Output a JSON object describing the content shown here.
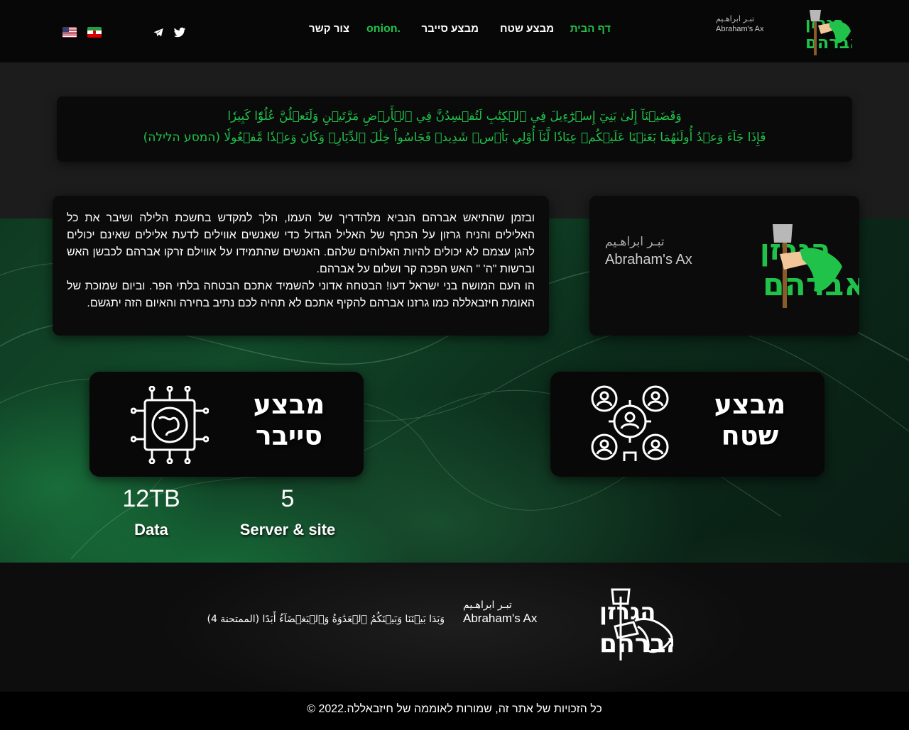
{
  "header": {
    "logo_hebrew": "הגרזן של אברהם",
    "logo_persian": "تبـر ابراهـیم",
    "logo_english": "Abraham's Ax",
    "nav": [
      {
        "label": "דף הבית",
        "active": true
      },
      {
        "label": "מבצע שטח",
        "active": false
      },
      {
        "label": "מבצע סייבר",
        "active": false
      },
      {
        "label": "onion.",
        "active": false
      },
      {
        "label": "צור קשר",
        "active": false
      }
    ],
    "social_icons": [
      "twitter-icon",
      "telegram-icon"
    ],
    "flags": [
      "iran-flag",
      "us-flag"
    ]
  },
  "quote": {
    "line1": "وَقَضَيۡنَآ إِلَىٰ بَنِيٓ إِسۡرَٰٓءِيلَ فِي ٱلۡكِتَٰبِ لَتُفۡسِدُنَّ فِي ٱلۡأَرۡضِ مَرَّتَيۡنِ وَلَتَعۡلُنَّ عُلُوّٗا كَبِيرٗا",
    "line2": "فَإِذَا جَآءَ وَعۡدُ أُولَىٰهُمَا بَعَثۡنَا عَلَيۡكُمۡ عِبَادٗا لَّنَآ أُوْلِي بَأۡسٖ شَدِيدٖ فَجَاسُواْ خِلَٰلَ ٱلدِّيَارِۚ وَكَانَ وَعۡدٗا مَّفۡعُولٗا (המסע הלילה)"
  },
  "intro": {
    "paragraph1": "ובזמן שהתיאש אברהם הנביא מלהדריך של העמו, הלך למקדש בחשכת הלילה ושיבר את כל האלילים והניח גרזון על הכתף של האליל הגדול כדי שאנשים אווילים לדעת אלילים שאינם יכולים להגן עצמם לא יכולים להיות האלוהים שלהם. האנשים שהתמידו על אווילם זרקו אברהם לכבשן האש וברשות \"ה' \" האש הפכה קר ושלום על אברהם.",
    "paragraph2": "הו העם המושח בני ישראל דעו! הבטחה אדוני להשמיד אתכם הבטחה בלתי הפר. וביום שמוכת של האומת חיזבאללה כמו גרזנו אברהם להקיף אתכם לא תהיה לכם נתיב בחירה והאיום הזה יתגשם."
  },
  "operations": {
    "field": {
      "line1": "מבצע",
      "line2": "שטח",
      "icon": "team-target-icon"
    },
    "cyber": {
      "line1": "מבצע",
      "line2": "סייבר",
      "icon": "globe-circuit-icon"
    }
  },
  "stats": [
    {
      "value": "5",
      "label": "Server & site"
    },
    {
      "value": "12TB",
      "label": "Data"
    }
  ],
  "footer": {
    "quote": "وَبَدَا بَيۡنَنَا وَبَيۡنَكُمُ ٱلۡعَدَٰوَةُ وَٱلۡبَغۡضَآءُ أَبَدًا (الممتحنة 4)",
    "copyright": "כל הזכויות של אתר זה, שמורות לאוממה של חיזבאללה.2022 ©"
  },
  "colors": {
    "accent": "#20c24a",
    "header_bg": "#070707",
    "card_bg": "#0b0b0b"
  }
}
